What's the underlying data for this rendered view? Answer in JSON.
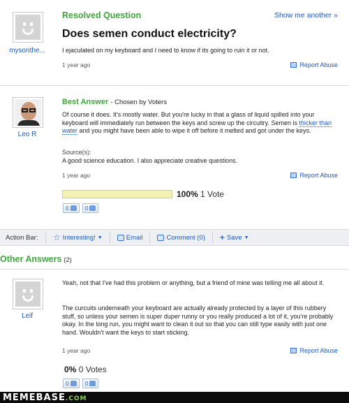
{
  "question": {
    "status": "Resolved Question",
    "show_another": "Show me another »",
    "title": "Does semen conduct electricity?",
    "body": "I ejaculated on my keyboard and I need to know if its going to ruin it or not.",
    "asker": "mysonthe...",
    "ago": "1 year ago",
    "report": "Report Abuse"
  },
  "best_answer": {
    "label": "Best Answer",
    "chosen_by": "- Chosen by Voters",
    "author": "Leo R",
    "text_1": "Of course it does. It's mostly water. But you're lucky in that a glass of liquid spilled into your keyboard will immediately run between the keys and screw up the circuitry. Semen is ",
    "link_text": "thicker than water",
    "text_2": " and you might have been able to wipe it off before it melted and got under the keys.",
    "sources_label": "Source(s):",
    "source": "A good science education. I also appreciate creative questions.",
    "ago": "1 year ago",
    "report": "Report Abuse",
    "vote_percent": "100%",
    "vote_count": "1 Vote",
    "vote_fraction": 1.0,
    "thumbs_up": "0",
    "thumbs_down": "0"
  },
  "action_bar": {
    "label": "Action Bar:",
    "interesting": "Interesting!",
    "email": "Email",
    "comment": "Comment (0)",
    "save": "Save"
  },
  "other_answers": {
    "header": "Other Answers",
    "count": "(2)",
    "author": "Leif",
    "para_1": "Yeah, not that I've had this problem or anything, but a friend of mine was telling me all about it.",
    "para_2": "The curcuits underneath your keyboard are actually already protected by a layer of this rubbery stuff, so unless your semen is super duper runny or you really produced a lot of it, you're probably okay. In the long run, you might want to clean it out so that you can still type easily with just one hand. Wouldn't want the keys to start sticking.",
    "ago": "1 year ago",
    "report": "Report Abuse",
    "vote_percent": "0%",
    "vote_count": "0 Votes",
    "thumbs_up": "0",
    "thumbs_down": "0"
  },
  "footer": {
    "logo": "MEMEBASE",
    "logo_suffix": ".COM"
  },
  "colors": {
    "green": "#3ea83a",
    "link": "#1e58c3",
    "vote_bar": "#f3f2b2"
  }
}
